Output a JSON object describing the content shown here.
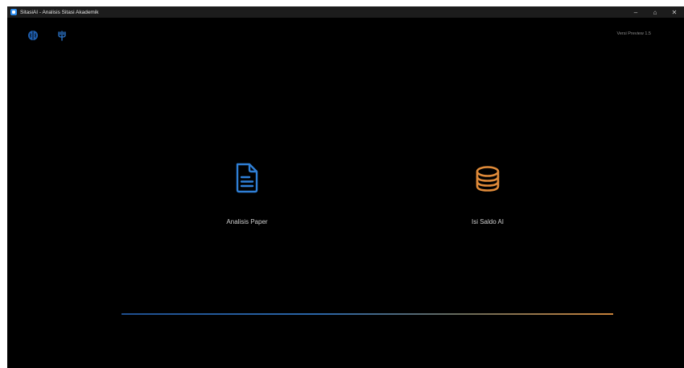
{
  "window": {
    "title": "SitasiAI - Analisis Sitasi Akademik",
    "controls": {
      "minimize": "–",
      "restore": "⌂",
      "close": "✕"
    }
  },
  "header": {
    "icons": [
      "brain-icon",
      "trident-icon"
    ],
    "version_text": "Versi Preview 1.5"
  },
  "menu": [
    {
      "label": "Analisis Paper",
      "icon": "document-icon",
      "color": "#2f7fd6"
    },
    {
      "label": "Isi Saldo AI",
      "icon": "coins-icon",
      "color": "#e08b3a"
    }
  ],
  "progress": {
    "value": 1.0,
    "color_start": "#1f4f8f",
    "color_end": "#c8823a"
  }
}
